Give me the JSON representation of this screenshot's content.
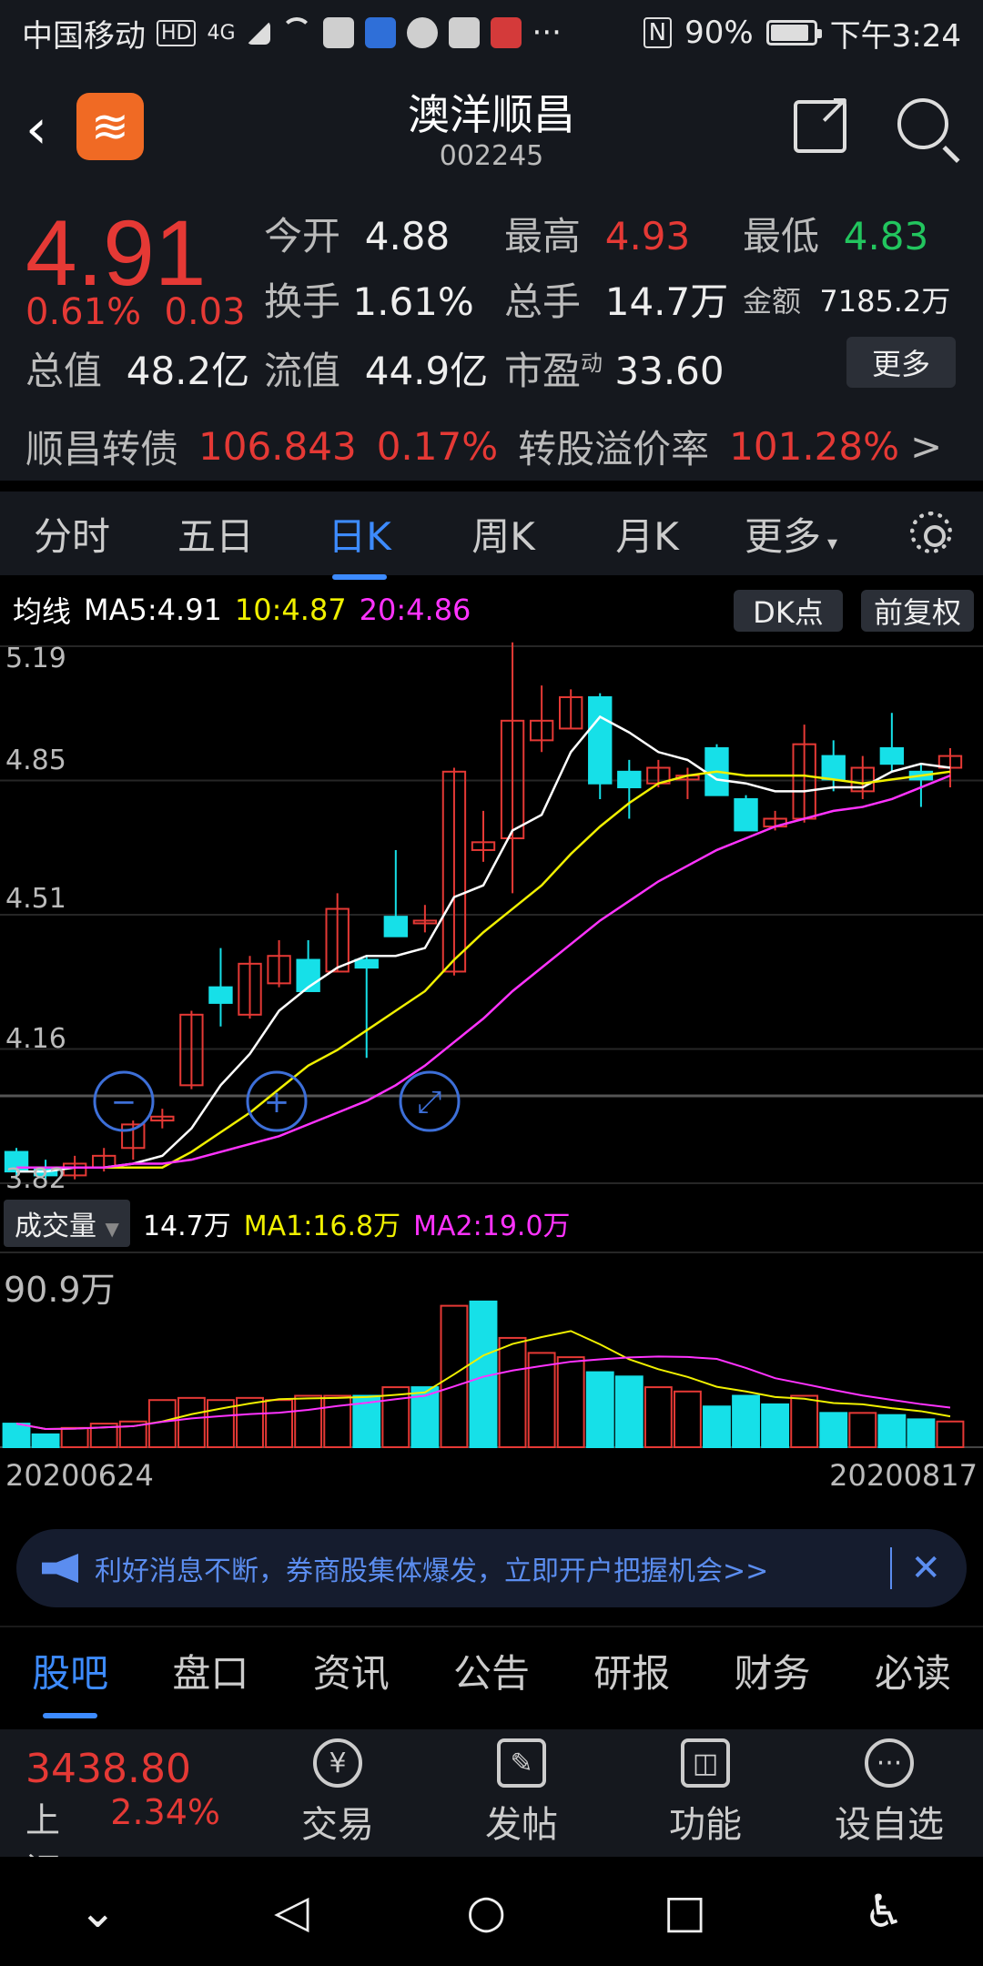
{
  "status": {
    "carrier": "中国移动",
    "hd": "HD",
    "net": "4G",
    "more": "···",
    "nfc": "N",
    "battery": "90%",
    "battery_level": 0.9,
    "time": "下午3:24"
  },
  "header": {
    "title": "澳洋顺昌",
    "code": "002245"
  },
  "quote": {
    "price": "4.91",
    "change_pct": "0.61%",
    "change": "0.03",
    "open_label": "今开",
    "open": "4.88",
    "high_label": "最高",
    "high": "4.93",
    "low_label": "最低",
    "low": "4.83",
    "turnover_label": "换手",
    "turnover": "1.61%",
    "volume_label": "总手",
    "volume": "14.7万",
    "amount_label": "金额",
    "amount": "7185.2万",
    "mktcap_label": "总值",
    "mktcap": "48.2亿",
    "float_label": "流值",
    "float": "44.9亿",
    "pe_label": "市盈",
    "pe_sup": "动",
    "pe": "33.60",
    "more_label": "更多"
  },
  "bond": {
    "name": "顺昌转债",
    "price": "106.843",
    "pct": "0.17%",
    "premium_label": "转股溢价率",
    "premium": "101.28%",
    "arrow": ">"
  },
  "tabs": [
    "分时",
    "五日",
    "日K",
    "周K",
    "月K",
    "更多"
  ],
  "active_tab": "日K",
  "ma": {
    "label": "均线",
    "ma5": "MA5:4.91",
    "ma10": "10:4.87",
    "ma20": "20:4.86",
    "dk_label": "DK点",
    "fq_label": "前复权",
    "colors": {
      "ma5": "#ffffff",
      "ma10": "#f0f000",
      "ma20": "#ff33ff",
      "up": "#e53935",
      "down": "#16e0e8"
    }
  },
  "chart_data": {
    "type": "candlestick",
    "y_ticks": [
      "5.19",
      "4.85",
      "4.51",
      "4.16",
      "3.82"
    ],
    "ylim": [
      3.82,
      5.19
    ],
    "x_start": "20200624",
    "x_end": "20200817",
    "candles": [
      {
        "o": 3.9,
        "c": 3.85,
        "h": 3.91,
        "l": 3.83
      },
      {
        "o": 3.86,
        "c": 3.84,
        "h": 3.88,
        "l": 3.83
      },
      {
        "o": 3.84,
        "c": 3.87,
        "h": 3.89,
        "l": 3.83
      },
      {
        "o": 3.86,
        "c": 3.89,
        "h": 3.91,
        "l": 3.85
      },
      {
        "o": 3.91,
        "c": 3.97,
        "h": 3.98,
        "l": 3.88
      },
      {
        "o": 3.98,
        "c": 3.99,
        "h": 4.01,
        "l": 3.96
      },
      {
        "o": 4.07,
        "c": 4.25,
        "h": 4.26,
        "l": 4.06
      },
      {
        "o": 4.32,
        "c": 4.28,
        "h": 4.42,
        "l": 4.22
      },
      {
        "o": 4.25,
        "c": 4.38,
        "h": 4.4,
        "l": 4.24
      },
      {
        "o": 4.33,
        "c": 4.4,
        "h": 4.44,
        "l": 4.32
      },
      {
        "o": 4.39,
        "c": 4.31,
        "h": 4.44,
        "l": 4.31
      },
      {
        "o": 4.36,
        "c": 4.52,
        "h": 4.56,
        "l": 4.36
      },
      {
        "o": 4.39,
        "c": 4.37,
        "h": 4.4,
        "l": 4.14
      },
      {
        "o": 4.5,
        "c": 4.45,
        "h": 4.67,
        "l": 4.45
      },
      {
        "o": 4.49,
        "c": 4.49,
        "h": 4.53,
        "l": 4.46
      },
      {
        "o": 4.36,
        "c": 4.87,
        "h": 4.88,
        "l": 4.35
      },
      {
        "o": 4.67,
        "c": 4.69,
        "h": 4.77,
        "l": 4.64
      },
      {
        "o": 4.7,
        "c": 5.0,
        "h": 5.2,
        "l": 4.56
      },
      {
        "o": 4.95,
        "c": 5.0,
        "h": 5.09,
        "l": 4.92
      },
      {
        "o": 4.98,
        "c": 5.06,
        "h": 5.08,
        "l": 4.98
      },
      {
        "o": 5.06,
        "c": 4.84,
        "h": 5.07,
        "l": 4.8
      },
      {
        "o": 4.87,
        "c": 4.83,
        "h": 4.9,
        "l": 4.75
      },
      {
        "o": 4.84,
        "c": 4.88,
        "h": 4.9,
        "l": 4.83
      },
      {
        "o": 4.85,
        "c": 4.86,
        "h": 4.88,
        "l": 4.8
      },
      {
        "o": 4.93,
        "c": 4.81,
        "h": 4.94,
        "l": 4.81
      },
      {
        "o": 4.8,
        "c": 4.72,
        "h": 4.81,
        "l": 4.72
      },
      {
        "o": 4.73,
        "c": 4.75,
        "h": 4.77,
        "l": 4.72
      },
      {
        "o": 4.75,
        "c": 4.94,
        "h": 4.99,
        "l": 4.74
      },
      {
        "o": 4.91,
        "c": 4.85,
        "h": 4.95,
        "l": 4.82
      },
      {
        "o": 4.82,
        "c": 4.88,
        "h": 4.91,
        "l": 4.8
      },
      {
        "o": 4.93,
        "c": 4.89,
        "h": 5.02,
        "l": 4.87
      },
      {
        "o": 4.87,
        "c": 4.85,
        "h": 4.89,
        "l": 4.78
      },
      {
        "o": 4.88,
        "c": 4.91,
        "h": 4.93,
        "l": 4.83
      }
    ],
    "ma5": [
      3.85,
      3.85,
      3.86,
      3.86,
      3.87,
      3.89,
      3.96,
      4.07,
      4.15,
      4.26,
      4.32,
      4.37,
      4.4,
      4.4,
      4.42,
      4.55,
      4.58,
      4.72,
      4.76,
      4.92,
      5.01,
      4.97,
      4.92,
      4.9,
      4.85,
      4.84,
      4.82,
      4.82,
      4.83,
      4.83,
      4.87,
      4.89,
      4.88
    ],
    "ma10": [
      3.86,
      3.86,
      3.86,
      3.86,
      3.86,
      3.86,
      3.9,
      3.95,
      4.0,
      4.06,
      4.12,
      4.16,
      4.21,
      4.26,
      4.31,
      4.39,
      4.46,
      4.52,
      4.58,
      4.66,
      4.73,
      4.79,
      4.84,
      4.86,
      4.87,
      4.86,
      4.86,
      4.86,
      4.85,
      4.84,
      4.85,
      4.86,
      4.87
    ],
    "ma20": [
      3.86,
      3.86,
      3.86,
      3.86,
      3.87,
      3.87,
      3.88,
      3.9,
      3.92,
      3.94,
      3.97,
      4.0,
      4.03,
      4.07,
      4.12,
      4.18,
      4.24,
      4.31,
      4.37,
      4.43,
      4.49,
      4.54,
      4.59,
      4.63,
      4.67,
      4.7,
      4.73,
      4.75,
      4.77,
      4.78,
      4.8,
      4.83,
      4.86
    ],
    "volume_max": 90.9,
    "volume": [
      11,
      6,
      9,
      11,
      12,
      22,
      23,
      22,
      23,
      22,
      24,
      24,
      24,
      28,
      28,
      66,
      68,
      51,
      44,
      42,
      35,
      33,
      28,
      26,
      19,
      24,
      20,
      24,
      16,
      16,
      15,
      13,
      12
    ],
    "volume_up": [
      false,
      false,
      true,
      true,
      true,
      true,
      true,
      true,
      true,
      true,
      true,
      true,
      false,
      true,
      false,
      true,
      false,
      true,
      true,
      true,
      false,
      false,
      true,
      true,
      false,
      false,
      false,
      true,
      false,
      true,
      false,
      false,
      true
    ]
  },
  "volume_panel": {
    "selector": "成交量",
    "value": "14.7万",
    "ma1": "MA1:16.8万",
    "ma2": "MA2:19.0万",
    "max_label": "90.9万"
  },
  "banner": {
    "text": "利好消息不断，券商股集体爆发，立即开户把握机会>>",
    "close": "✕"
  },
  "subtabs": [
    "股吧",
    "盘口",
    "资讯",
    "公告",
    "研报",
    "财务",
    "必读"
  ],
  "active_subtab": "股吧",
  "toolbar": {
    "index_value": "3438.80",
    "index_name": "上证",
    "index_pct": "2.34%",
    "items": [
      {
        "label": "交易",
        "icon": "¥"
      },
      {
        "label": "发帖",
        "icon": "✎"
      },
      {
        "label": "功能",
        "icon": "◫"
      },
      {
        "label": "设自选",
        "icon": "···"
      }
    ]
  },
  "navbar": {
    "back": "⌄",
    "tri": "◁",
    "home": "○",
    "recent": "□",
    "access": "♿"
  }
}
